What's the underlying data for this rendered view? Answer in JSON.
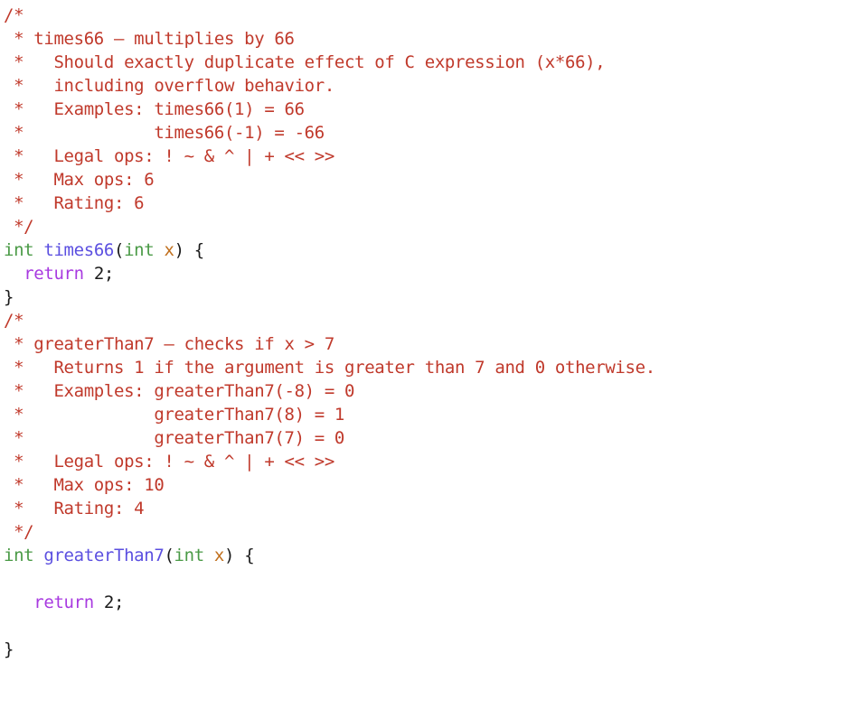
{
  "editor": {
    "language": "C",
    "background_color": "#ffffff",
    "colors": {
      "comment": "#c0392b",
      "keyword": "#4a9a46",
      "function_name": "#5b4fe0",
      "control_keyword": "#a83ae0",
      "parameter": "#c1701e",
      "plain": "#1a1a1a"
    },
    "lines": [
      {
        "id": 1,
        "segments": [
          {
            "t": "/*",
            "c": "comment"
          }
        ]
      },
      {
        "id": 2,
        "segments": [
          {
            "t": " * times66 – multiplies by 66",
            "c": "comment"
          }
        ]
      },
      {
        "id": 3,
        "segments": [
          {
            "t": " *   Should exactly duplicate effect of C expression (x*66),",
            "c": "comment"
          }
        ]
      },
      {
        "id": 4,
        "segments": [
          {
            "t": " *   including overflow behavior.",
            "c": "comment"
          }
        ]
      },
      {
        "id": 5,
        "segments": [
          {
            "t": " *   Examples: times66(1) = 66",
            "c": "comment"
          }
        ]
      },
      {
        "id": 6,
        "segments": [
          {
            "t": " *             times66(-1) = -66",
            "c": "comment"
          }
        ]
      },
      {
        "id": 7,
        "segments": [
          {
            "t": " *   Legal ops: ! ~ & ^ | + << >>",
            "c": "comment"
          }
        ]
      },
      {
        "id": 8,
        "segments": [
          {
            "t": " *   Max ops: 6",
            "c": "comment"
          }
        ]
      },
      {
        "id": 9,
        "segments": [
          {
            "t": " *   Rating: 6",
            "c": "comment"
          }
        ]
      },
      {
        "id": 10,
        "segments": [
          {
            "t": " */",
            "c": "comment"
          }
        ]
      },
      {
        "id": 11,
        "segments": [
          {
            "t": "int",
            "c": "keyword"
          },
          {
            "t": " ",
            "c": "plain"
          },
          {
            "t": "times66",
            "c": "function"
          },
          {
            "t": "(",
            "c": "plain"
          },
          {
            "t": "int",
            "c": "keyword"
          },
          {
            "t": " ",
            "c": "plain"
          },
          {
            "t": "x",
            "c": "param"
          },
          {
            "t": ") {",
            "c": "plain"
          }
        ]
      },
      {
        "id": 12,
        "segments": [
          {
            "t": "  ",
            "c": "plain"
          },
          {
            "t": "return",
            "c": "control"
          },
          {
            "t": " 2;",
            "c": "plain"
          }
        ]
      },
      {
        "id": 13,
        "segments": [
          {
            "t": "}",
            "c": "plain"
          }
        ]
      },
      {
        "id": 14,
        "segments": [
          {
            "t": "/*",
            "c": "comment"
          }
        ]
      },
      {
        "id": 15,
        "segments": [
          {
            "t": " * greaterThan7 – checks if x > 7",
            "c": "comment"
          }
        ]
      },
      {
        "id": 16,
        "segments": [
          {
            "t": " *   Returns 1 if the argument is greater than 7 and 0 otherwise.",
            "c": "comment"
          }
        ]
      },
      {
        "id": 17,
        "segments": [
          {
            "t": " *   Examples: greaterThan7(-8) = 0",
            "c": "comment"
          }
        ]
      },
      {
        "id": 18,
        "segments": [
          {
            "t": " *             greaterThan7(8) = 1",
            "c": "comment"
          }
        ]
      },
      {
        "id": 19,
        "segments": [
          {
            "t": " *             greaterThan7(7) = 0",
            "c": "comment"
          }
        ]
      },
      {
        "id": 20,
        "segments": [
          {
            "t": " *   Legal ops: ! ~ & ^ | + << >>",
            "c": "comment"
          }
        ]
      },
      {
        "id": 21,
        "segments": [
          {
            "t": " *   Max ops: 10",
            "c": "comment"
          }
        ]
      },
      {
        "id": 22,
        "segments": [
          {
            "t": " *   Rating: 4",
            "c": "comment"
          }
        ]
      },
      {
        "id": 23,
        "segments": [
          {
            "t": " */",
            "c": "comment"
          }
        ]
      },
      {
        "id": 24,
        "segments": [
          {
            "t": "int",
            "c": "keyword"
          },
          {
            "t": " ",
            "c": "plain"
          },
          {
            "t": "greaterThan7",
            "c": "function"
          },
          {
            "t": "(",
            "c": "plain"
          },
          {
            "t": "int",
            "c": "keyword"
          },
          {
            "t": " ",
            "c": "plain"
          },
          {
            "t": "x",
            "c": "param"
          },
          {
            "t": ") {",
            "c": "plain"
          }
        ]
      },
      {
        "id": 25,
        "segments": []
      },
      {
        "id": 26,
        "segments": [
          {
            "t": "   ",
            "c": "plain"
          },
          {
            "t": "return",
            "c": "control"
          },
          {
            "t": " 2;",
            "c": "plain"
          }
        ]
      },
      {
        "id": 27,
        "segments": []
      },
      {
        "id": 28,
        "segments": [
          {
            "t": "}",
            "c": "plain"
          }
        ]
      }
    ]
  }
}
